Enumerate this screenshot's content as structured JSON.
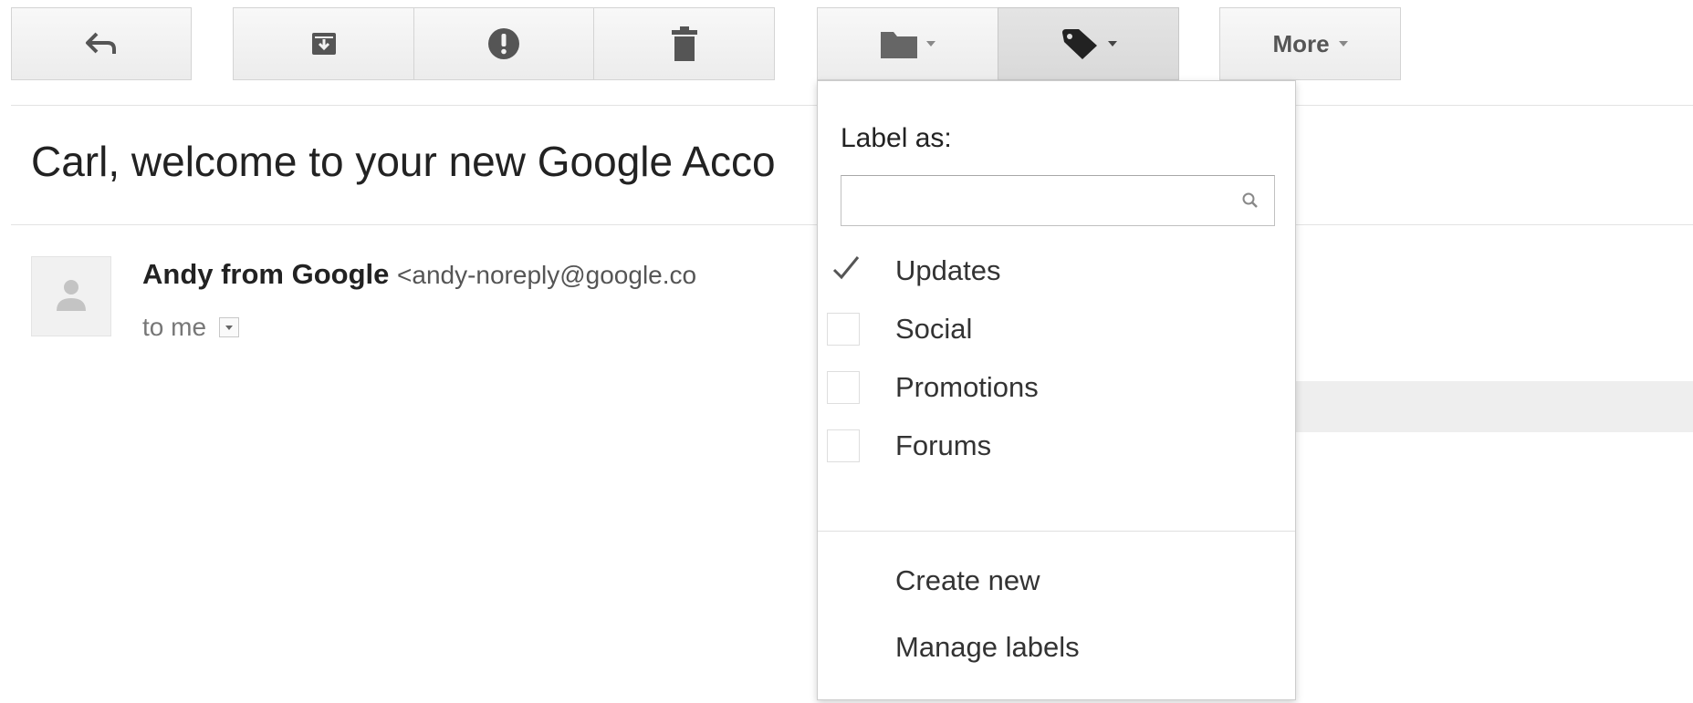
{
  "toolbar": {
    "back": {
      "icon": "back-arrow-icon"
    },
    "archive": {
      "icon": "archive-icon"
    },
    "spam": {
      "icon": "report-spam-icon"
    },
    "delete": {
      "icon": "trash-icon"
    },
    "move_to": {
      "icon": "folder-icon"
    },
    "labels": {
      "icon": "label-tag-icon",
      "state": "open"
    },
    "more_label": "More"
  },
  "message": {
    "subject": "Carl, welcome to your new Google Acco",
    "sender_name": "Andy from Google",
    "sender_email": "<andy-noreply@google.co",
    "recipient": "to me"
  },
  "label_menu": {
    "title": "Label as:",
    "search": {
      "value": "",
      "placeholder": ""
    },
    "items": [
      {
        "label": "Updates",
        "checked": true
      },
      {
        "label": "Social",
        "checked": false
      },
      {
        "label": "Promotions",
        "checked": false
      },
      {
        "label": "Forums",
        "checked": false
      }
    ],
    "actions": {
      "create_new": "Create new",
      "manage_labels": "Manage labels"
    }
  },
  "colors": {
    "toolbar_bg": "#f3f3f3",
    "toolbar_active_bg": "#dedede",
    "menu_border": "#cccccc",
    "text": "#222222"
  }
}
